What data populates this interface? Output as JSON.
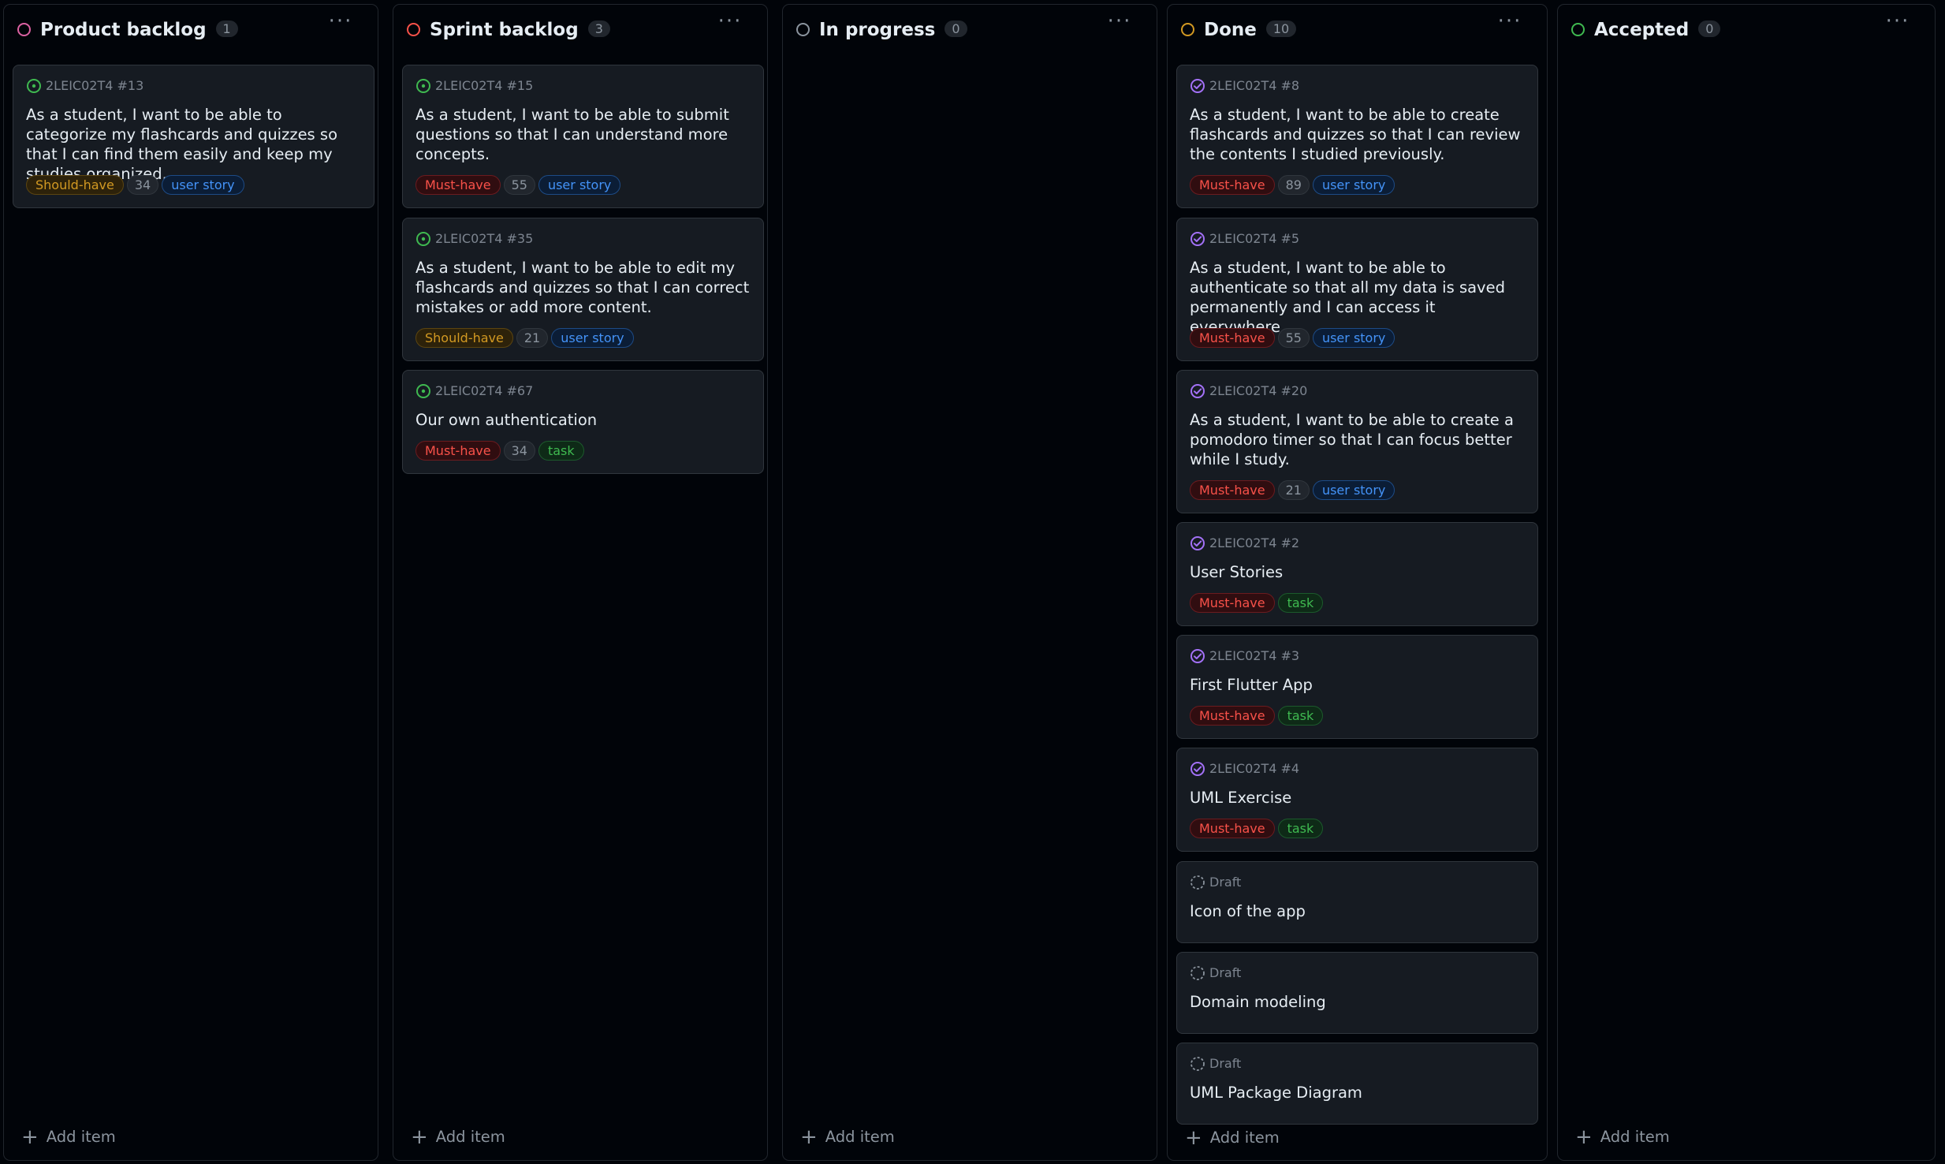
{
  "columns": [
    {
      "title": "Product backlog",
      "count": "1",
      "status_color": "#db61a2",
      "add_label": "Add item",
      "cards": [
        {
          "meta": "2LEIC02T4 #13",
          "icon": "open-issue-icon",
          "title": "As a student, I want to be able to categorize my flashcards and quizzes so that I can find them easily and keep my studies organized.",
          "labels": [
            {
              "text": "Should-have",
              "kind": "should"
            },
            {
              "text": "34",
              "kind": "num"
            },
            {
              "text": "user story",
              "kind": "story"
            }
          ]
        }
      ]
    },
    {
      "title": "Sprint backlog",
      "count": "3",
      "status_color": "#f85149",
      "add_label": "Add item",
      "cards": [
        {
          "meta": "2LEIC02T4 #15",
          "icon": "open-issue-icon",
          "title": "As a student, I want to be able to submit questions so that I can understand more concepts.",
          "labels": [
            {
              "text": "Must-have",
              "kind": "must"
            },
            {
              "text": "55",
              "kind": "num"
            },
            {
              "text": "user story",
              "kind": "story"
            }
          ]
        },
        {
          "meta": "2LEIC02T4 #35",
          "icon": "open-issue-icon",
          "title": "As a student, I want to be able to edit my flashcards and quizzes so that I can correct mistakes or add more content.",
          "labels": [
            {
              "text": "Should-have",
              "kind": "should"
            },
            {
              "text": "21",
              "kind": "num"
            },
            {
              "text": "user story",
              "kind": "story"
            }
          ]
        },
        {
          "meta": "2LEIC02T4 #67",
          "icon": "open-issue-icon",
          "title": "Our own authentication",
          "labels": [
            {
              "text": "Must-have",
              "kind": "must"
            },
            {
              "text": "34",
              "kind": "num"
            },
            {
              "text": "task",
              "kind": "task"
            }
          ]
        }
      ]
    },
    {
      "title": "In progress",
      "count": "0",
      "status_color": "#8b949e",
      "add_label": "Add item",
      "cards": []
    },
    {
      "title": "Done",
      "count": "10",
      "status_color": "#d29922",
      "add_label": "Add item",
      "cards": [
        {
          "meta": "2LEIC02T4 #8",
          "icon": "closed-issue-icon",
          "title": "As a student, I want to be able to create flashcards and quizzes so that I can review the contents I studied previously.",
          "labels": [
            {
              "text": "Must-have",
              "kind": "must"
            },
            {
              "text": "89",
              "kind": "num"
            },
            {
              "text": "user story",
              "kind": "story"
            }
          ]
        },
        {
          "meta": "2LEIC02T4 #5",
          "icon": "closed-issue-icon",
          "title": "As a student, I want to be able to authenticate so that all my data is saved permanently and I can access it everywhere.",
          "labels": [
            {
              "text": "Must-have",
              "kind": "must"
            },
            {
              "text": "55",
              "kind": "num"
            },
            {
              "text": "user story",
              "kind": "story"
            }
          ]
        },
        {
          "meta": "2LEIC02T4 #20",
          "icon": "closed-issue-icon",
          "title": "As a student, I want to be able to create a pomodoro timer so that I can focus better while I study.",
          "labels": [
            {
              "text": "Must-have",
              "kind": "must"
            },
            {
              "text": "21",
              "kind": "num"
            },
            {
              "text": "user story",
              "kind": "story"
            }
          ]
        },
        {
          "meta": "2LEIC02T4 #2",
          "icon": "closed-issue-icon",
          "title": "User Stories",
          "labels": [
            {
              "text": "Must-have",
              "kind": "must"
            },
            {
              "text": "task",
              "kind": "task"
            }
          ]
        },
        {
          "meta": "2LEIC02T4 #3",
          "icon": "closed-issue-icon",
          "title": "First Flutter App",
          "labels": [
            {
              "text": "Must-have",
              "kind": "must"
            },
            {
              "text": "task",
              "kind": "task"
            }
          ]
        },
        {
          "meta": "2LEIC02T4 #4",
          "icon": "closed-issue-icon",
          "title": "UML Exercise",
          "labels": [
            {
              "text": "Must-have",
              "kind": "must"
            },
            {
              "text": "task",
              "kind": "task"
            }
          ]
        },
        {
          "meta": "Draft",
          "icon": "draft-issue-icon",
          "title": "Icon of the app",
          "labels": []
        },
        {
          "meta": "Draft",
          "icon": "draft-issue-icon",
          "title": "Domain modeling",
          "labels": []
        },
        {
          "meta": "Draft",
          "icon": "draft-issue-icon",
          "title": "UML Package Diagram",
          "labels": []
        }
      ]
    },
    {
      "title": "Accepted",
      "count": "0",
      "status_color": "#3fb950",
      "add_label": "Add item",
      "cards": []
    }
  ]
}
